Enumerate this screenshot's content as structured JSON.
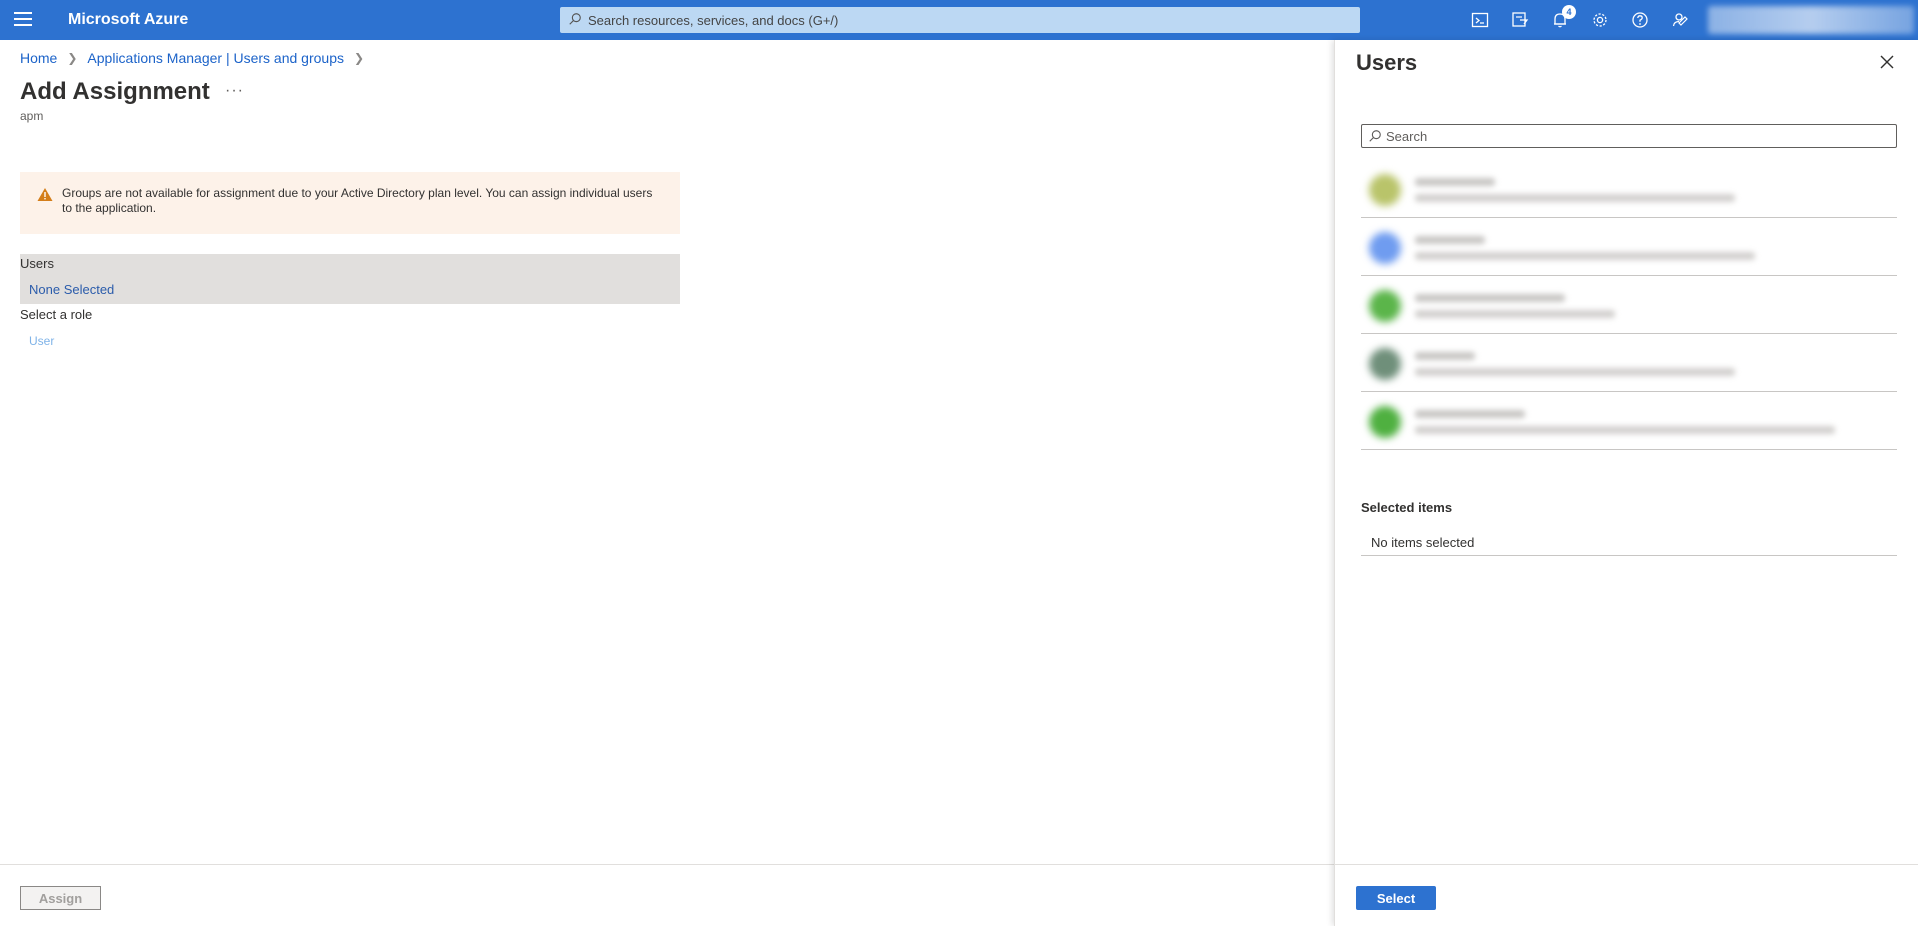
{
  "topbar": {
    "brand": "Microsoft Azure",
    "search_placeholder": "Search resources, services, and docs (G+/)",
    "notification_count": "4",
    "icons": [
      "cloud-shell-icon",
      "directory-filter-icon",
      "bell-icon",
      "gear-icon",
      "help-icon",
      "feedback-icon"
    ],
    "accent": "#2d72d0"
  },
  "breadcrumb": {
    "home": "Home",
    "parent": "Applications Manager | Users and groups"
  },
  "page": {
    "title": "Add Assignment",
    "more": "···",
    "subtitle": "apm"
  },
  "warning": {
    "text": "Groups are not available for assignment due to your Active Directory plan level. You can assign individual users to the application."
  },
  "form": {
    "users_label": "Users",
    "users_value": "None Selected",
    "role_label": "Select a role",
    "role_value": "User"
  },
  "footer": {
    "assign_label": "Assign"
  },
  "panel": {
    "title": "Users",
    "search_placeholder": "Search",
    "users": [
      {
        "avatar_color": "#b9c46a"
      },
      {
        "avatar_color": "#6f9cf0"
      },
      {
        "avatar_color": "#5bb54a"
      },
      {
        "avatar_color": "#6f8f7a"
      },
      {
        "avatar_color": "#4fb040"
      }
    ],
    "selected_title": "Selected items",
    "selected_empty": "No items selected",
    "select_label": "Select"
  }
}
